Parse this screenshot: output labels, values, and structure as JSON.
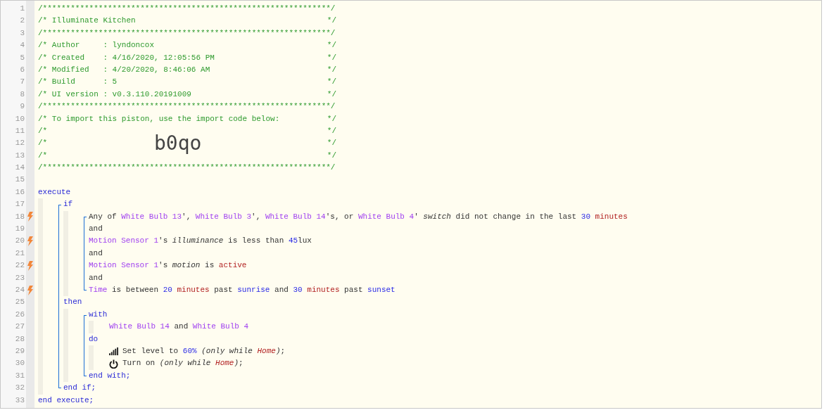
{
  "header": [
    {
      "n": "1",
      "text": "/**************************************************************/"
    },
    {
      "n": "2",
      "text": "/* Illuminate Kitchen",
      "end": "*/"
    },
    {
      "n": "3",
      "text": "/**************************************************************/"
    },
    {
      "n": "4",
      "text": "/* Author     : lyndoncox",
      "end": "*/"
    },
    {
      "n": "5",
      "text": "/* Created    : 4/16/2020, 12:05:56 PM",
      "end": "*/"
    },
    {
      "n": "6",
      "text": "/* Modified   : 4/20/2020, 8:46:06 AM",
      "end": "*/"
    },
    {
      "n": "7",
      "text": "/* Build      : 5",
      "end": "*/"
    },
    {
      "n": "8",
      "text": "/* UI version : v0.3.110.20191009",
      "end": "*/"
    },
    {
      "n": "9",
      "text": "/**************************************************************/"
    },
    {
      "n": "10",
      "text": "/* To import this piston, use the import code below:",
      "end": "*/"
    },
    {
      "n": "11",
      "text": "/*",
      "end": "*/"
    },
    {
      "n": "12",
      "text": "/*",
      "code": "b0qo",
      "end": "*/"
    },
    {
      "n": "13",
      "text": "/*",
      "end": "*/"
    },
    {
      "n": "14",
      "text": "/**************************************************************/"
    }
  ],
  "body": [
    {
      "kind": "line",
      "n": "15",
      "trigger": false
    },
    {
      "kind": "line",
      "n": "16",
      "trigger": false,
      "tokens": [
        {
          "t": "execute",
          "kind": "keyword"
        }
      ]
    },
    {
      "kind": "indent",
      "items": [
        {
          "kind": "bracket",
          "items": [
            {
              "kind": "line",
              "n": "17",
              "trigger": false,
              "tokens": [
                {
                  "t": "if",
                  "kind": "keyword"
                }
              ]
            },
            {
              "kind": "indent",
              "items": [
                {
                  "kind": "bracket",
                  "items": [
                    {
                      "kind": "line",
                      "n": "18",
                      "trigger": true,
                      "tokens": [
                        {
                          "t": "Any of ",
                          "kind": "plain"
                        },
                        {
                          "t": "White Bulb 13",
                          "kind": "device"
                        },
                        {
                          "t": "', ",
                          "kind": "plain"
                        },
                        {
                          "t": "White Bulb 3",
                          "kind": "device"
                        },
                        {
                          "t": "', ",
                          "kind": "plain"
                        },
                        {
                          "t": "White Bulb 14",
                          "kind": "device"
                        },
                        {
                          "t": "'s, or ",
                          "kind": "plain"
                        },
                        {
                          "t": "White Bulb 4",
                          "kind": "device"
                        },
                        {
                          "t": "' ",
                          "kind": "plain"
                        },
                        {
                          "t": "switch",
                          "kind": "italic"
                        },
                        {
                          "t": " did not change in the last ",
                          "kind": "plain"
                        },
                        {
                          "t": "30",
                          "kind": "number"
                        },
                        {
                          "t": " minutes",
                          "kind": "constant"
                        }
                      ]
                    },
                    {
                      "kind": "line",
                      "n": "19",
                      "trigger": false,
                      "tokens": [
                        {
                          "t": "and",
                          "kind": "plain"
                        }
                      ]
                    },
                    {
                      "kind": "line",
                      "n": "20",
                      "trigger": true,
                      "tokens": [
                        {
                          "t": "Motion Sensor 1",
                          "kind": "device"
                        },
                        {
                          "t": "'s ",
                          "kind": "plain"
                        },
                        {
                          "t": "illuminance",
                          "kind": "italic"
                        },
                        {
                          "t": " is less than ",
                          "kind": "plain"
                        },
                        {
                          "t": "45",
                          "kind": "number"
                        },
                        {
                          "t": "lux",
                          "kind": "plain"
                        }
                      ]
                    },
                    {
                      "kind": "line",
                      "n": "21",
                      "trigger": false,
                      "tokens": [
                        {
                          "t": "and",
                          "kind": "plain"
                        }
                      ]
                    },
                    {
                      "kind": "line",
                      "n": "22",
                      "trigger": true,
                      "tokens": [
                        {
                          "t": "Motion Sensor 1",
                          "kind": "device"
                        },
                        {
                          "t": "'s ",
                          "kind": "plain"
                        },
                        {
                          "t": "motion",
                          "kind": "italic"
                        },
                        {
                          "t": " is ",
                          "kind": "plain"
                        },
                        {
                          "t": "active",
                          "kind": "constant"
                        }
                      ]
                    },
                    {
                      "kind": "line",
                      "n": "23",
                      "trigger": false,
                      "tokens": [
                        {
                          "t": "and",
                          "kind": "plain"
                        }
                      ]
                    },
                    {
                      "kind": "line",
                      "n": "24",
                      "trigger": true,
                      "tokens": [
                        {
                          "t": "Time",
                          "kind": "device"
                        },
                        {
                          "t": " is between ",
                          "kind": "plain"
                        },
                        {
                          "t": "20",
                          "kind": "number"
                        },
                        {
                          "t": " minutes",
                          "kind": "constant"
                        },
                        {
                          "t": " past ",
                          "kind": "plain"
                        },
                        {
                          "t": "sunrise",
                          "kind": "event"
                        },
                        {
                          "t": " and ",
                          "kind": "plain"
                        },
                        {
                          "t": "30",
                          "kind": "number"
                        },
                        {
                          "t": " minutes",
                          "kind": "constant"
                        },
                        {
                          "t": " past ",
                          "kind": "plain"
                        },
                        {
                          "t": "sunset",
                          "kind": "event"
                        }
                      ]
                    }
                  ]
                }
              ]
            },
            {
              "kind": "line",
              "n": "25",
              "trigger": false,
              "tokens": [
                {
                  "t": "then",
                  "kind": "keyword"
                }
              ]
            },
            {
              "kind": "indent",
              "items": [
                {
                  "kind": "bracket",
                  "items": [
                    {
                      "kind": "line",
                      "n": "26",
                      "trigger": false,
                      "tokens": [
                        {
                          "t": "with",
                          "kind": "keyword"
                        }
                      ]
                    },
                    {
                      "kind": "indent",
                      "items": [
                        {
                          "kind": "line",
                          "n": "27",
                          "trigger": false,
                          "tokens": [
                            {
                              "t": "White Bulb 14",
                              "kind": "device"
                            },
                            {
                              "t": " and ",
                              "kind": "plain"
                            },
                            {
                              "t": "White Bulb 4",
                              "kind": "device"
                            }
                          ]
                        }
                      ]
                    },
                    {
                      "kind": "line",
                      "n": "28",
                      "trigger": false,
                      "tokens": [
                        {
                          "t": "do",
                          "kind": "keyword"
                        }
                      ]
                    },
                    {
                      "kind": "indent",
                      "items": [
                        {
                          "kind": "level-action",
                          "n": "29",
                          "trigger": false,
                          "tokens": [
                            {
                              "t": "Set level to ",
                              "kind": "plain"
                            },
                            {
                              "t": "60%",
                              "kind": "number"
                            },
                            {
                              "t": " (only while ",
                              "kind": "italic"
                            },
                            {
                              "t": "Home",
                              "kind": "constant-italic"
                            },
                            {
                              "t": ")",
                              "kind": "italic"
                            },
                            {
                              "t": ";",
                              "kind": "plain"
                            }
                          ]
                        },
                        {
                          "kind": "power-action",
                          "n": "30",
                          "trigger": false,
                          "tokens": [
                            {
                              "t": "Turn on ",
                              "kind": "plain"
                            },
                            {
                              "t": "(only while ",
                              "kind": "italic"
                            },
                            {
                              "t": "Home",
                              "kind": "constant-italic"
                            },
                            {
                              "t": ")",
                              "kind": "italic"
                            },
                            {
                              "t": ";",
                              "kind": "plain"
                            }
                          ]
                        }
                      ]
                    },
                    {
                      "kind": "line",
                      "n": "31",
                      "trigger": false,
                      "tokens": [
                        {
                          "t": "end with;",
                          "kind": "keyword"
                        }
                      ]
                    }
                  ]
                }
              ]
            },
            {
              "kind": "line",
              "n": "32",
              "trigger": false,
              "tokens": [
                {
                  "t": "end if;",
                  "kind": "keyword"
                }
              ]
            }
          ]
        }
      ]
    },
    {
      "kind": "line",
      "n": "33",
      "trigger": false,
      "tokens": [
        {
          "t": "end execute;",
          "kind": "keyword"
        }
      ]
    }
  ]
}
